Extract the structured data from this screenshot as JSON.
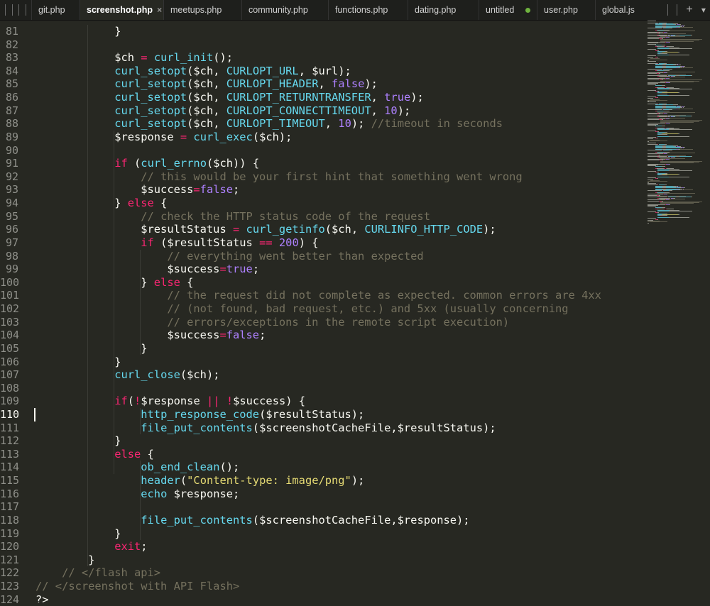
{
  "tabs": [
    {
      "label": "git.php",
      "active": false,
      "dirty": false
    },
    {
      "label": "screenshot.php",
      "active": true,
      "dirty": false
    },
    {
      "label": "meetups.php",
      "active": false,
      "dirty": false
    },
    {
      "label": "community.php",
      "active": false,
      "dirty": false
    },
    {
      "label": "functions.php",
      "active": false,
      "dirty": false
    },
    {
      "label": "dating.php",
      "active": false,
      "dirty": false
    },
    {
      "label": "untitled",
      "active": false,
      "dirty": true
    },
    {
      "label": "user.php",
      "active": false,
      "dirty": false
    },
    {
      "label": "global.js",
      "active": false,
      "dirty": false
    }
  ],
  "close_glyph": "×",
  "new_tab_glyph": "+",
  "tab_menu_glyph": "▾",
  "current_line": 110,
  "colors": {
    "background": "#272822",
    "keyword": "#f92672",
    "function": "#66d9ef",
    "comment": "#75715e",
    "number": "#ae81ff",
    "string": "#e6db74",
    "text": "#f8f8f2"
  },
  "lines": [
    {
      "n": "81",
      "tokens": [
        [
          "            }",
          ""
        ]
      ]
    },
    {
      "n": "82",
      "tokens": []
    },
    {
      "n": "83",
      "tokens": [
        [
          "            $ch ",
          ""
        ],
        [
          "=",
          "k"
        ],
        [
          " ",
          ""
        ],
        [
          "curl_init",
          "f"
        ],
        [
          "();",
          ""
        ]
      ]
    },
    {
      "n": "84",
      "tokens": [
        [
          "            ",
          ""
        ],
        [
          "curl_setopt",
          "f"
        ],
        [
          "($ch, ",
          ""
        ],
        [
          "CURLOPT_URL",
          "f"
        ],
        [
          ", $url);",
          ""
        ]
      ]
    },
    {
      "n": "85",
      "tokens": [
        [
          "            ",
          ""
        ],
        [
          "curl_setopt",
          "f"
        ],
        [
          "($ch, ",
          ""
        ],
        [
          "CURLOPT_HEADER",
          "f"
        ],
        [
          ", ",
          ""
        ],
        [
          "false",
          "n"
        ],
        [
          ");",
          ""
        ]
      ]
    },
    {
      "n": "86",
      "tokens": [
        [
          "            ",
          ""
        ],
        [
          "curl_setopt",
          "f"
        ],
        [
          "($ch, ",
          ""
        ],
        [
          "CURLOPT_RETURNTRANSFER",
          "f"
        ],
        [
          ", ",
          ""
        ],
        [
          "true",
          "n"
        ],
        [
          ");",
          ""
        ]
      ]
    },
    {
      "n": "87",
      "tokens": [
        [
          "            ",
          ""
        ],
        [
          "curl_setopt",
          "f"
        ],
        [
          "($ch, ",
          ""
        ],
        [
          "CURLOPT_CONNECTTIMEOUT",
          "f"
        ],
        [
          ", ",
          ""
        ],
        [
          "10",
          "n"
        ],
        [
          ");",
          ""
        ]
      ]
    },
    {
      "n": "88",
      "tokens": [
        [
          "            ",
          ""
        ],
        [
          "curl_setopt",
          "f"
        ],
        [
          "($ch, ",
          ""
        ],
        [
          "CURLOPT_TIMEOUT",
          "f"
        ],
        [
          ", ",
          ""
        ],
        [
          "10",
          "n"
        ],
        [
          "); ",
          ""
        ],
        [
          "//timeout in seconds",
          "c"
        ]
      ]
    },
    {
      "n": "89",
      "tokens": [
        [
          "            $response ",
          ""
        ],
        [
          "=",
          "k"
        ],
        [
          " ",
          ""
        ],
        [
          "curl_exec",
          "f"
        ],
        [
          "($ch);",
          ""
        ]
      ]
    },
    {
      "n": "90",
      "tokens": []
    },
    {
      "n": "91",
      "tokens": [
        [
          "            ",
          ""
        ],
        [
          "if",
          "k"
        ],
        [
          " (",
          ""
        ],
        [
          "curl_errno",
          "f"
        ],
        [
          "($ch)) {",
          ""
        ]
      ]
    },
    {
      "n": "92",
      "tokens": [
        [
          "                ",
          ""
        ],
        [
          "// this would be your first hint that something went wrong",
          "c"
        ]
      ]
    },
    {
      "n": "93",
      "tokens": [
        [
          "                $success",
          ""
        ],
        [
          "=",
          "k"
        ],
        [
          "false",
          "n"
        ],
        [
          ";",
          ""
        ]
      ]
    },
    {
      "n": "94",
      "tokens": [
        [
          "            } ",
          ""
        ],
        [
          "else",
          "k"
        ],
        [
          " {",
          ""
        ]
      ]
    },
    {
      "n": "95",
      "tokens": [
        [
          "                ",
          ""
        ],
        [
          "// check the HTTP status code of the request",
          "c"
        ]
      ]
    },
    {
      "n": "96",
      "tokens": [
        [
          "                $resultStatus ",
          ""
        ],
        [
          "=",
          "k"
        ],
        [
          " ",
          ""
        ],
        [
          "curl_getinfo",
          "f"
        ],
        [
          "($ch, ",
          ""
        ],
        [
          "CURLINFO_HTTP_CODE",
          "f"
        ],
        [
          ");",
          ""
        ]
      ]
    },
    {
      "n": "97",
      "tokens": [
        [
          "                ",
          ""
        ],
        [
          "if",
          "k"
        ],
        [
          " ($resultStatus ",
          ""
        ],
        [
          "==",
          "k"
        ],
        [
          " ",
          ""
        ],
        [
          "200",
          "n"
        ],
        [
          ") {",
          ""
        ]
      ]
    },
    {
      "n": "98",
      "tokens": [
        [
          "                    ",
          ""
        ],
        [
          "// everything went better than expected",
          "c"
        ]
      ]
    },
    {
      "n": "99",
      "tokens": [
        [
          "                    $success",
          ""
        ],
        [
          "=",
          "k"
        ],
        [
          "true",
          "n"
        ],
        [
          ";",
          ""
        ]
      ]
    },
    {
      "n": "100",
      "tokens": [
        [
          "                } ",
          ""
        ],
        [
          "else",
          "k"
        ],
        [
          " {",
          ""
        ]
      ]
    },
    {
      "n": "101",
      "tokens": [
        [
          "                    ",
          ""
        ],
        [
          "// the request did not complete as expected. common errors are 4xx",
          "c"
        ]
      ]
    },
    {
      "n": "102",
      "tokens": [
        [
          "                    ",
          ""
        ],
        [
          "// (not found, bad request, etc.) and 5xx (usually concerning",
          "c"
        ]
      ]
    },
    {
      "n": "103",
      "tokens": [
        [
          "                    ",
          ""
        ],
        [
          "// errors/exceptions in the remote script execution)",
          "c"
        ]
      ]
    },
    {
      "n": "104",
      "tokens": [
        [
          "                    $success",
          ""
        ],
        [
          "=",
          "k"
        ],
        [
          "false",
          "n"
        ],
        [
          ";",
          ""
        ]
      ]
    },
    {
      "n": "105",
      "tokens": [
        [
          "                }",
          ""
        ]
      ]
    },
    {
      "n": "106",
      "tokens": [
        [
          "            }",
          ""
        ]
      ]
    },
    {
      "n": "107",
      "tokens": [
        [
          "            ",
          ""
        ],
        [
          "curl_close",
          "f"
        ],
        [
          "($ch);",
          ""
        ]
      ]
    },
    {
      "n": "108",
      "tokens": []
    },
    {
      "n": "109",
      "tokens": [
        [
          "            ",
          ""
        ],
        [
          "if",
          "k"
        ],
        [
          "(",
          ""
        ],
        [
          "!",
          "k"
        ],
        [
          "$response ",
          ""
        ],
        [
          "||",
          "k"
        ],
        [
          " ",
          ""
        ],
        [
          "!",
          "k"
        ],
        [
          "$success) {",
          ""
        ]
      ]
    },
    {
      "n": "110",
      "tokens": [
        [
          "                ",
          ""
        ],
        [
          "http_response_code",
          "f"
        ],
        [
          "($resultStatus);",
          ""
        ]
      ]
    },
    {
      "n": "111",
      "tokens": [
        [
          "                ",
          ""
        ],
        [
          "file_put_contents",
          "f"
        ],
        [
          "($screenshotCacheFile,$resultStatus);",
          ""
        ]
      ]
    },
    {
      "n": "112",
      "tokens": [
        [
          "            }",
          ""
        ]
      ]
    },
    {
      "n": "113",
      "tokens": [
        [
          "            ",
          ""
        ],
        [
          "else",
          "k"
        ],
        [
          " {",
          ""
        ]
      ]
    },
    {
      "n": "114",
      "tokens": [
        [
          "                ",
          ""
        ],
        [
          "ob_end_clean",
          "f"
        ],
        [
          "();",
          ""
        ]
      ]
    },
    {
      "n": "115",
      "tokens": [
        [
          "                ",
          ""
        ],
        [
          "header",
          "f"
        ],
        [
          "(",
          ""
        ],
        [
          "\"Content-type: image/png\"",
          "s"
        ],
        [
          ");",
          ""
        ]
      ]
    },
    {
      "n": "116",
      "tokens": [
        [
          "                ",
          ""
        ],
        [
          "echo",
          "f"
        ],
        [
          " $response;",
          ""
        ]
      ]
    },
    {
      "n": "117",
      "tokens": []
    },
    {
      "n": "118",
      "tokens": [
        [
          "                ",
          ""
        ],
        [
          "file_put_contents",
          "f"
        ],
        [
          "($screenshotCacheFile,$response);",
          ""
        ]
      ]
    },
    {
      "n": "119",
      "tokens": [
        [
          "            }",
          ""
        ]
      ]
    },
    {
      "n": "120",
      "tokens": [
        [
          "            ",
          ""
        ],
        [
          "exit",
          "k"
        ],
        [
          ";",
          ""
        ]
      ]
    },
    {
      "n": "121",
      "tokens": [
        [
          "        }",
          ""
        ]
      ]
    },
    {
      "n": "122",
      "tokens": [
        [
          "    ",
          ""
        ],
        [
          "// </flash api>",
          "c"
        ]
      ]
    },
    {
      "n": "123",
      "tokens": [
        [
          "",
          ""
        ],
        [
          "// </screenshot with API Flash>",
          "c"
        ]
      ]
    },
    {
      "n": "124",
      "tokens": [
        [
          "?>",
          ""
        ]
      ]
    }
  ]
}
